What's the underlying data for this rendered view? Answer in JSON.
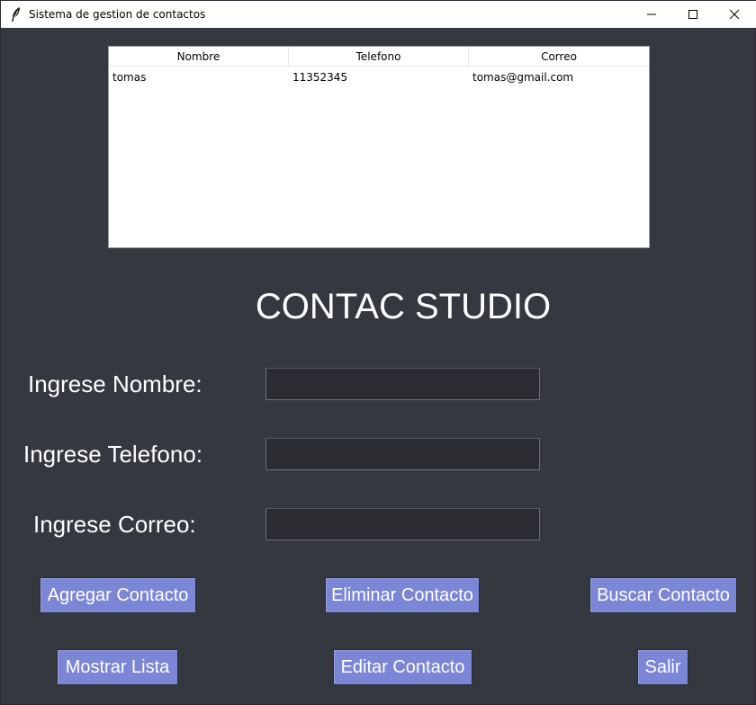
{
  "window": {
    "title": "Sistema de gestion de contactos"
  },
  "table": {
    "columns": [
      "Nombre",
      "Telefono",
      "Correo"
    ],
    "rows": [
      [
        "tomas",
        "11352345",
        "tomas@gmail.com"
      ]
    ]
  },
  "heading": "CONTAC STUDIO",
  "form": {
    "nombre_label": "Ingrese Nombre:",
    "nombre_value": "",
    "telefono_label": "Ingrese Telefono:",
    "telefono_value": "",
    "correo_label": "Ingrese Correo:",
    "correo_value": ""
  },
  "buttons": {
    "agregar": "Agregar Contacto",
    "eliminar": "Eliminar Contacto",
    "buscar": "Buscar Contacto",
    "mostrar": "Mostrar Lista",
    "editar": "Editar Contacto",
    "salir": "Salir"
  },
  "colors": {
    "background": "#363840",
    "button": "#7b86d6",
    "field": "#2b2c31"
  },
  "icons": {
    "app": "feather-icon",
    "minimize": "minimize-icon",
    "maximize": "maximize-icon",
    "close": "close-icon"
  }
}
